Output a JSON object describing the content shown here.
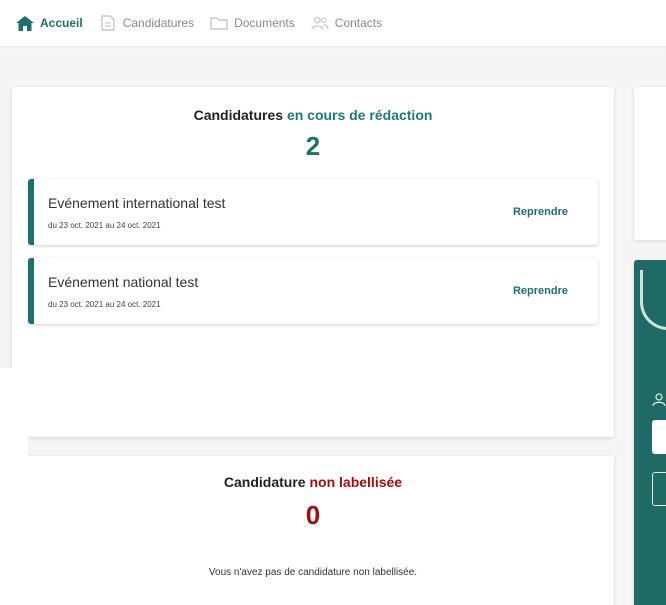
{
  "nav": {
    "items": [
      {
        "label": "Accueil",
        "icon": "home-icon",
        "active": true
      },
      {
        "label": "Candidatures",
        "icon": "document-icon",
        "active": false
      },
      {
        "label": "Documents",
        "icon": "folder-icon",
        "active": false
      },
      {
        "label": "Contacts",
        "icon": "contacts-icon",
        "active": false
      }
    ]
  },
  "drafts": {
    "title_prefix": "Candidatures",
    "title_accent": "en cours de rédaction",
    "count": "2",
    "items": [
      {
        "name": "Evénement international test",
        "dates": "du 23 oct. 2021 au 24 oct. 2021",
        "action": "Reprendre"
      },
      {
        "name": "Evénement national test",
        "dates": "du 23 oct. 2021 au 24 oct. 2021",
        "action": "Reprendre"
      }
    ]
  },
  "unlabelled": {
    "title_prefix": "Candidature",
    "title_accent": "non labellisée",
    "count": "0",
    "message": "Vous n'avez pas de candidature non labellisée."
  },
  "colors": {
    "accent_teal": "#1f6f6a",
    "accent_red": "#a11010",
    "panel_dark": "#1f6a64"
  }
}
